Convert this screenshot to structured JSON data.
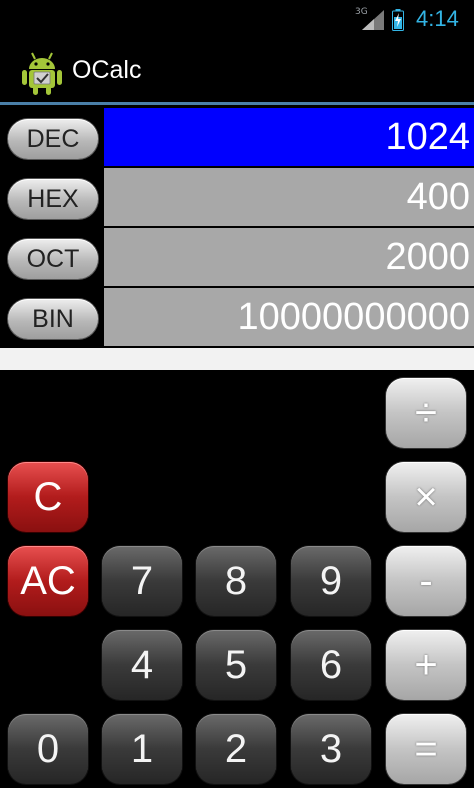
{
  "status_bar": {
    "network": "3G",
    "time": "4:14",
    "icons": [
      "signal-icon",
      "battery-icon"
    ]
  },
  "action_bar": {
    "title": "OCalc",
    "icon": "android-icon"
  },
  "bases": [
    {
      "label": "DEC",
      "value": "1024",
      "active": true
    },
    {
      "label": "HEX",
      "value": "400",
      "active": false
    },
    {
      "label": "OCT",
      "value": "2000",
      "active": false
    },
    {
      "label": "BIN",
      "value": "10000000000",
      "active": false
    }
  ],
  "keys": {
    "divide": "÷",
    "multiply": "×",
    "clear": "C",
    "all_clear": "AC",
    "seven": "7",
    "eight": "8",
    "nine": "9",
    "minus": "-",
    "four": "4",
    "five": "5",
    "six": "6",
    "plus": "+",
    "zero": "0",
    "one": "1",
    "two": "2",
    "three": "3",
    "equals": "="
  },
  "colors": {
    "active_row": "#0000ff",
    "inactive_row": "#a8a8a8",
    "clear_key": "#b21c1c",
    "time_text": "#33b5e5"
  }
}
